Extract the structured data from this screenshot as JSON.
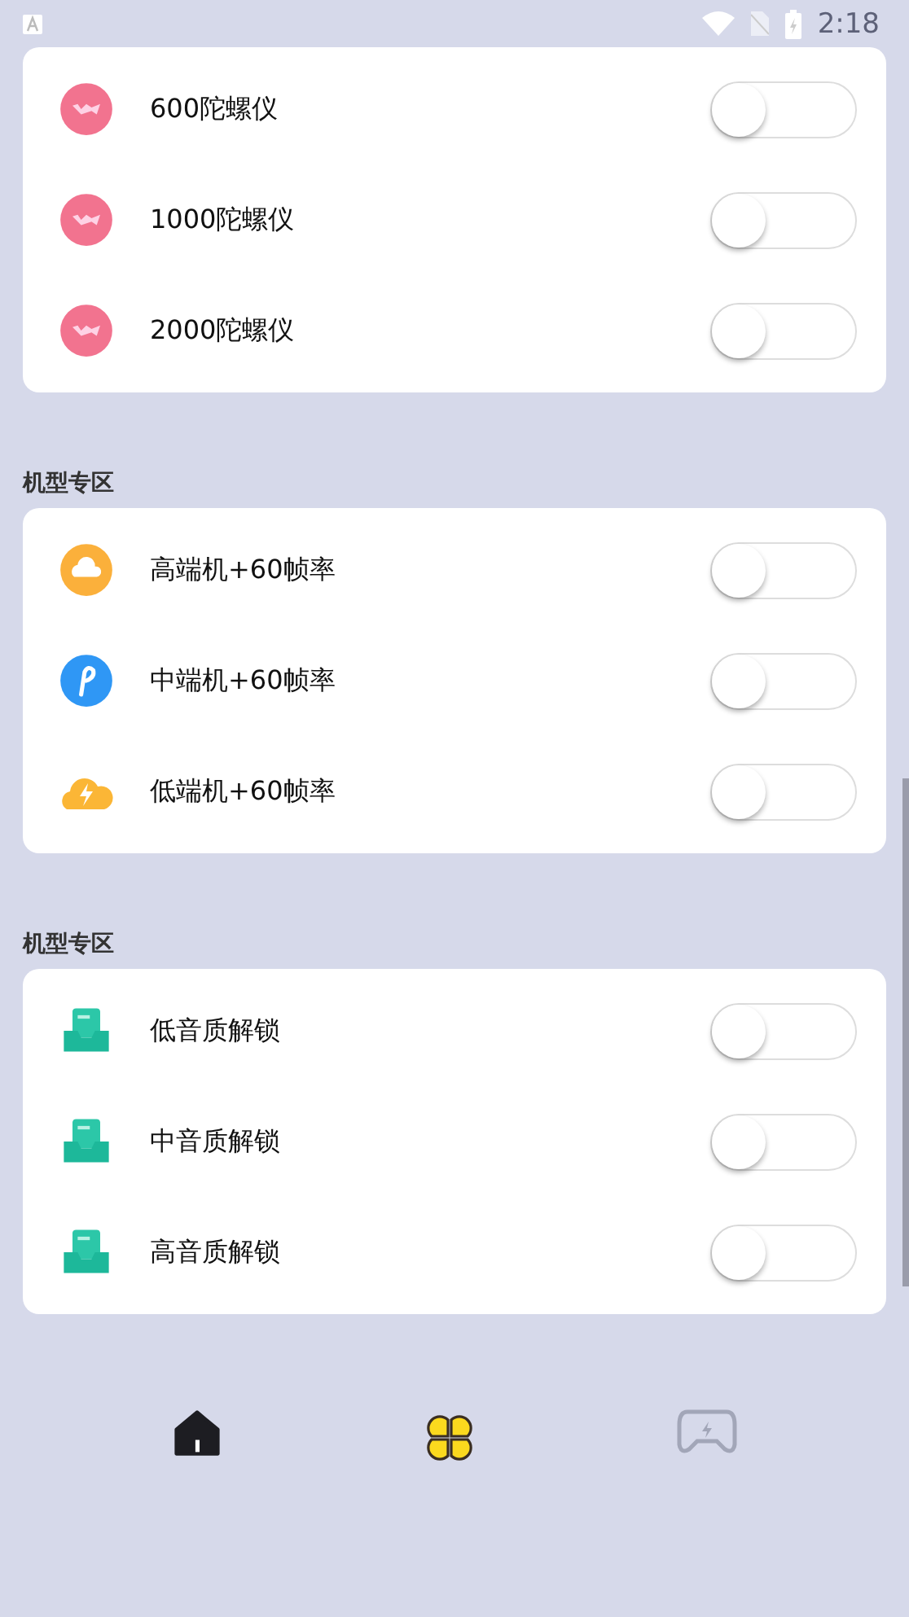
{
  "status_bar": {
    "time": "2:18"
  },
  "sections": [
    {
      "items": [
        {
          "kind": "gyro",
          "label": "600陀螺仪",
          "on": false
        },
        {
          "kind": "gyro",
          "label": "1000陀螺仪",
          "on": false
        },
        {
          "kind": "gyro",
          "label": "2000陀螺仪",
          "on": false
        }
      ]
    },
    {
      "title": "机型专区",
      "items": [
        {
          "kind": "cloud",
          "label": "高端机+60帧率",
          "on": false
        },
        {
          "kind": "pen",
          "label": "中端机+60帧率",
          "on": false
        },
        {
          "kind": "storm",
          "label": "低端机+60帧率",
          "on": false
        }
      ]
    },
    {
      "title": "机型专区",
      "items": [
        {
          "kind": "tray",
          "label": "低音质解锁",
          "on": false
        },
        {
          "kind": "tray",
          "label": "中音质解锁",
          "on": false
        },
        {
          "kind": "tray",
          "label": "高音质解锁",
          "on": false
        }
      ]
    }
  ],
  "nav": [
    {
      "kind": "home"
    },
    {
      "kind": "clover"
    },
    {
      "kind": "gamepad"
    }
  ]
}
